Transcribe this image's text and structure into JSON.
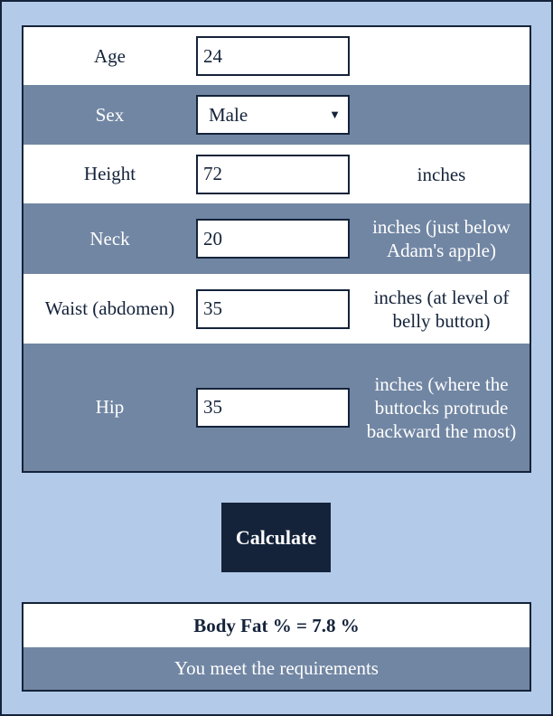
{
  "form": {
    "age": {
      "label": "Age",
      "value": "24"
    },
    "sex": {
      "label": "Sex",
      "value": "Male"
    },
    "height": {
      "label": "Height",
      "value": "72",
      "unit": "inches"
    },
    "neck": {
      "label": "Neck",
      "value": "20",
      "unit": "inches (just below Adam's apple)"
    },
    "waist": {
      "label": "Waist (abdomen)",
      "value": "35",
      "unit": "inches (at level of belly button)"
    },
    "hip": {
      "label": "Hip",
      "value": "35",
      "unit": "inches (where the buttocks protrude backward the most)"
    }
  },
  "calculate_label": "Calculate",
  "result": {
    "body_fat": "Body Fat % = 7.8 %",
    "message": "You meet the requirements"
  },
  "colors": {
    "background": "#b3cae8",
    "dark": "#14233a",
    "row_alt": "#7186a3"
  }
}
